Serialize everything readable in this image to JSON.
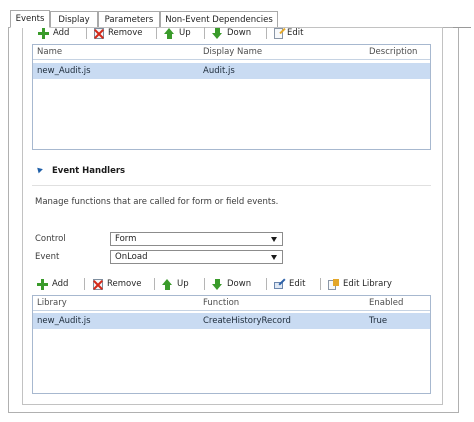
{
  "tabs": [
    {
      "label": "Events",
      "active": true
    },
    {
      "label": "Display",
      "active": false
    },
    {
      "label": "Parameters",
      "active": false
    },
    {
      "label": "Non-Event Dependencies",
      "active": false
    }
  ],
  "libraries": {
    "toolbar": {
      "add": "Add",
      "remove": "Remove",
      "up": "Up",
      "down": "Down",
      "edit": "Edit"
    },
    "columns": {
      "name": "Name",
      "display_name": "Display Name",
      "description": "Description"
    },
    "rows": [
      {
        "name": "new_Audit.js",
        "display_name": "Audit.js",
        "description": ""
      }
    ]
  },
  "event_handlers": {
    "title": "Event Handlers",
    "description": "Manage functions that are called for form or field events.",
    "control_label": "Control",
    "control_value": "Form",
    "event_label": "Event",
    "event_value": "OnLoad",
    "toolbar": {
      "add": "Add",
      "remove": "Remove",
      "up": "Up",
      "down": "Down",
      "edit": "Edit",
      "edit_library": "Edit Library"
    },
    "columns": {
      "library": "Library",
      "function": "Function",
      "enabled": "Enabled"
    },
    "rows": [
      {
        "library": "new_Audit.js",
        "function": "CreateHistoryRecord",
        "enabled": "True"
      }
    ]
  },
  "colors": {
    "selected_row": "#c9dbf2",
    "grid_border": "#a7b8cf",
    "accent_green": "#3a9b2b",
    "remove_red": "#d32a1a"
  }
}
